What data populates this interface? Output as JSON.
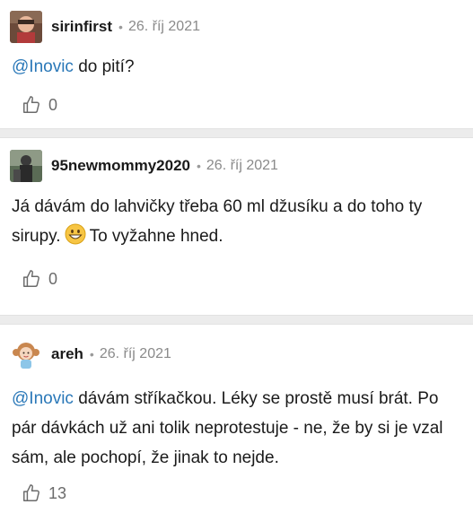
{
  "comments": [
    {
      "username": "sirinfirst",
      "date": "26. říj 2021",
      "mention": "@Inovic",
      "text": " do pití?",
      "likes": "0",
      "avatar_icon": "user-photo-avatar"
    },
    {
      "username": "95newmommy2020",
      "date": "26. říj 2021",
      "text_before_emoji": "Já dávám do lahvičky třeba 60 ml džusíku a do toho ty sirupy.",
      "emoji": "grinning-face-emoji",
      "text_after_emoji": "To vyžahne hned.",
      "likes": "0",
      "avatar_icon": "user-photo-avatar"
    },
    {
      "username": "areh",
      "date": "26. říj 2021",
      "mention": "@Inovic",
      "text": " dávám stříkačkou. Léky se prostě musí brát. Po pár dávkách už ani tolik neprotestuje - ne, že by si je vzal sám, ale pochopí, že jinak to nejde.",
      "likes": "13",
      "avatar_icon": "cartoon-girl-avatar"
    }
  ],
  "separator": "•",
  "colors": {
    "mention": "#2a78b8",
    "meta": "#8a8a8a",
    "separator_band": "#ececec"
  }
}
